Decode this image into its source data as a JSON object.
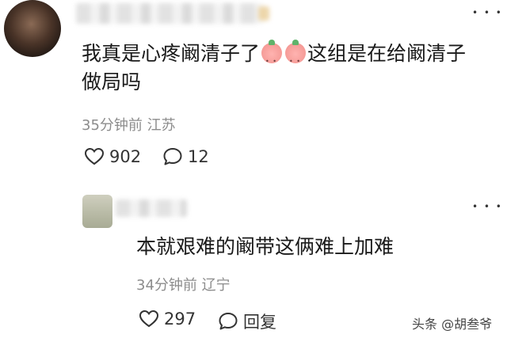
{
  "comments": [
    {
      "text_line1_a": "我真是心疼阚清子了",
      "text_line1_b": "这组是在给阚清子",
      "text_line2": "做局吗",
      "emojis": [
        "peach-face-emoji",
        "peach-face-emoji"
      ],
      "time": "35分钟前",
      "location": "江苏",
      "likes": "902",
      "replies": "12"
    },
    {
      "text": "本就艰难的阚带这俩难上加难",
      "time": "34分钟前",
      "location": "辽宁",
      "likes": "297",
      "reply_label": "回复"
    }
  ],
  "more_glyph": "• • •",
  "watermark": "头条 @胡叁爷",
  "icons": {
    "like": "heart-outline-icon",
    "reply": "speech-bubble-icon",
    "more": "more-dots-icon"
  }
}
